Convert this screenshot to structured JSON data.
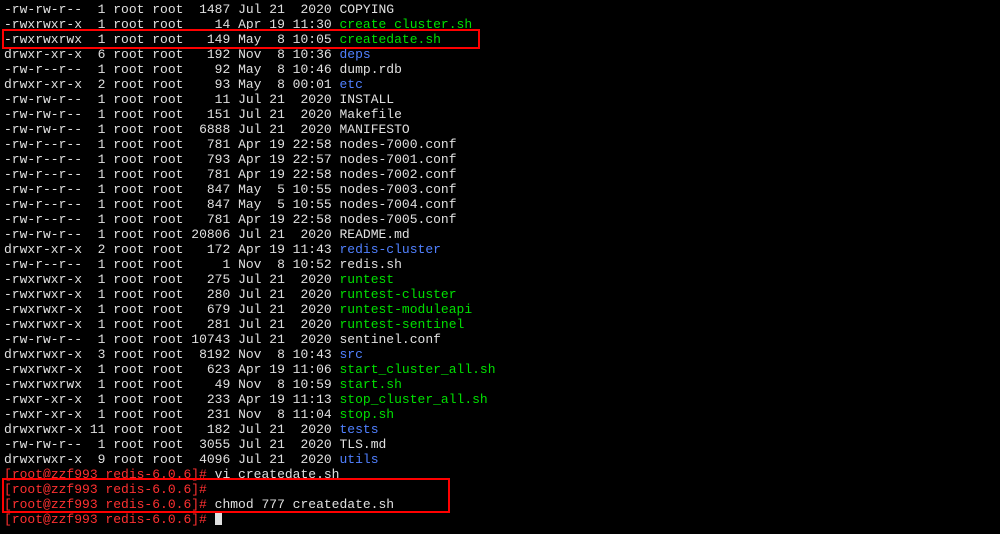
{
  "listing": [
    {
      "perms": "-rw-rw-r--",
      "links": "1",
      "owner": "root",
      "group": "root",
      "size": "1487",
      "date": "Jul 21  2020",
      "name": "COPYING",
      "color": "white"
    },
    {
      "perms": "-rwxrwxr-x",
      "links": "1",
      "owner": "root",
      "group": "root",
      "size": "14",
      "date": "Apr 19 11:30",
      "name": "create_cluster.sh",
      "color": "green"
    },
    {
      "perms": "-rwxrwxrwx",
      "links": "1",
      "owner": "root",
      "group": "root",
      "size": "149",
      "date": "May  8 10:05",
      "name": "createdate.sh",
      "color": "green"
    },
    {
      "perms": "drwxr-xr-x",
      "links": "6",
      "owner": "root",
      "group": "root",
      "size": "192",
      "date": "Nov  8 10:36",
      "name": "deps",
      "color": "blue"
    },
    {
      "perms": "-rw-r--r--",
      "links": "1",
      "owner": "root",
      "group": "root",
      "size": "92",
      "date": "May  8 10:46",
      "name": "dump.rdb",
      "color": "white"
    },
    {
      "perms": "drwxr-xr-x",
      "links": "2",
      "owner": "root",
      "group": "root",
      "size": "93",
      "date": "May  8 00:01",
      "name": "etc",
      "color": "blue"
    },
    {
      "perms": "-rw-rw-r--",
      "links": "1",
      "owner": "root",
      "group": "root",
      "size": "11",
      "date": "Jul 21  2020",
      "name": "INSTALL",
      "color": "white"
    },
    {
      "perms": "-rw-rw-r--",
      "links": "1",
      "owner": "root",
      "group": "root",
      "size": "151",
      "date": "Jul 21  2020",
      "name": "Makefile",
      "color": "white"
    },
    {
      "perms": "-rw-rw-r--",
      "links": "1",
      "owner": "root",
      "group": "root",
      "size": "6888",
      "date": "Jul 21  2020",
      "name": "MANIFESTO",
      "color": "white"
    },
    {
      "perms": "-rw-r--r--",
      "links": "1",
      "owner": "root",
      "group": "root",
      "size": "781",
      "date": "Apr 19 22:58",
      "name": "nodes-7000.conf",
      "color": "white"
    },
    {
      "perms": "-rw-r--r--",
      "links": "1",
      "owner": "root",
      "group": "root",
      "size": "793",
      "date": "Apr 19 22:57",
      "name": "nodes-7001.conf",
      "color": "white"
    },
    {
      "perms": "-rw-r--r--",
      "links": "1",
      "owner": "root",
      "group": "root",
      "size": "781",
      "date": "Apr 19 22:58",
      "name": "nodes-7002.conf",
      "color": "white"
    },
    {
      "perms": "-rw-r--r--",
      "links": "1",
      "owner": "root",
      "group": "root",
      "size": "847",
      "date": "May  5 10:55",
      "name": "nodes-7003.conf",
      "color": "white"
    },
    {
      "perms": "-rw-r--r--",
      "links": "1",
      "owner": "root",
      "group": "root",
      "size": "847",
      "date": "May  5 10:55",
      "name": "nodes-7004.conf",
      "color": "white"
    },
    {
      "perms": "-rw-r--r--",
      "links": "1",
      "owner": "root",
      "group": "root",
      "size": "781",
      "date": "Apr 19 22:58",
      "name": "nodes-7005.conf",
      "color": "white"
    },
    {
      "perms": "-rw-rw-r--",
      "links": "1",
      "owner": "root",
      "group": "root",
      "size": "20806",
      "date": "Jul 21  2020",
      "name": "README.md",
      "color": "white"
    },
    {
      "perms": "drwxr-xr-x",
      "links": "2",
      "owner": "root",
      "group": "root",
      "size": "172",
      "date": "Apr 19 11:43",
      "name": "redis-cluster",
      "color": "blue"
    },
    {
      "perms": "-rw-r--r--",
      "links": "1",
      "owner": "root",
      "group": "root",
      "size": "1",
      "date": "Nov  8 10:52",
      "name": "redis.sh",
      "color": "white"
    },
    {
      "perms": "-rwxrwxr-x",
      "links": "1",
      "owner": "root",
      "group": "root",
      "size": "275",
      "date": "Jul 21  2020",
      "name": "runtest",
      "color": "green"
    },
    {
      "perms": "-rwxrwxr-x",
      "links": "1",
      "owner": "root",
      "group": "root",
      "size": "280",
      "date": "Jul 21  2020",
      "name": "runtest-cluster",
      "color": "green"
    },
    {
      "perms": "-rwxrwxr-x",
      "links": "1",
      "owner": "root",
      "group": "root",
      "size": "679",
      "date": "Jul 21  2020",
      "name": "runtest-moduleapi",
      "color": "green"
    },
    {
      "perms": "-rwxrwxr-x",
      "links": "1",
      "owner": "root",
      "group": "root",
      "size": "281",
      "date": "Jul 21  2020",
      "name": "runtest-sentinel",
      "color": "green"
    },
    {
      "perms": "-rw-rw-r--",
      "links": "1",
      "owner": "root",
      "group": "root",
      "size": "10743",
      "date": "Jul 21  2020",
      "name": "sentinel.conf",
      "color": "white"
    },
    {
      "perms": "drwxrwxr-x",
      "links": "3",
      "owner": "root",
      "group": "root",
      "size": "8192",
      "date": "Nov  8 10:43",
      "name": "src",
      "color": "blue"
    },
    {
      "perms": "-rwxrwxr-x",
      "links": "1",
      "owner": "root",
      "group": "root",
      "size": "623",
      "date": "Apr 19 11:06",
      "name": "start_cluster_all.sh",
      "color": "green"
    },
    {
      "perms": "-rwxrwxrwx",
      "links": "1",
      "owner": "root",
      "group": "root",
      "size": "49",
      "date": "Nov  8 10:59",
      "name": "start.sh",
      "color": "green"
    },
    {
      "perms": "-rwxr-xr-x",
      "links": "1",
      "owner": "root",
      "group": "root",
      "size": "233",
      "date": "Apr 19 11:13",
      "name": "stop_cluster_all.sh",
      "color": "green"
    },
    {
      "perms": "-rwxr-xr-x",
      "links": "1",
      "owner": "root",
      "group": "root",
      "size": "231",
      "date": "Nov  8 11:04",
      "name": "stop.sh",
      "color": "green"
    },
    {
      "perms": "drwxrwxr-x",
      "links": "11",
      "owner": "root",
      "group": "root",
      "size": "182",
      "date": "Jul 21  2020",
      "name": "tests",
      "color": "blue"
    },
    {
      "perms": "-rw-rw-r--",
      "links": "1",
      "owner": "root",
      "group": "root",
      "size": "3055",
      "date": "Jul 21  2020",
      "name": "TLS.md",
      "color": "white"
    },
    {
      "perms": "drwxrwxr-x",
      "links": "9",
      "owner": "root",
      "group": "root",
      "size": "4096",
      "date": "Jul 21  2020",
      "name": "utils",
      "color": "blue"
    }
  ],
  "prompts": [
    {
      "user": "root",
      "host": "zzf993",
      "cwd": "redis-6.0.6",
      "cmd": "vi createdate.sh"
    },
    {
      "user": "root",
      "host": "zzf993",
      "cwd": "redis-6.0.6",
      "cmd": ""
    },
    {
      "user": "root",
      "host": "zzf993",
      "cwd": "redis-6.0.6",
      "cmd": "chmod 777 createdate.sh"
    },
    {
      "user": "root",
      "host": "zzf993",
      "cwd": "redis-6.0.6",
      "cmd": ""
    }
  ]
}
